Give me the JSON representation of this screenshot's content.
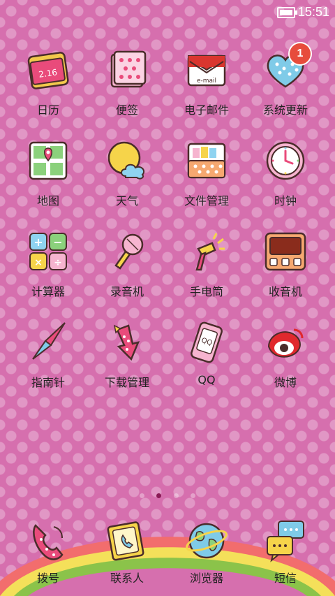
{
  "status_bar": {
    "time": "15:51",
    "battery_icon": "battery-icon"
  },
  "apps": [
    {
      "label": "日历",
      "icon": "calendar-icon",
      "icon_text": "2.16"
    },
    {
      "label": "便签",
      "icon": "notes-icon"
    },
    {
      "label": "电子邮件",
      "icon": "email-icon",
      "icon_text": "e-mail"
    },
    {
      "label": "系统更新",
      "icon": "update-heart-icon",
      "badge": "1"
    },
    {
      "label": "地图",
      "icon": "map-icon"
    },
    {
      "label": "天气",
      "icon": "weather-icon"
    },
    {
      "label": "文件管理",
      "icon": "file-manager-icon"
    },
    {
      "label": "时钟",
      "icon": "clock-icon"
    },
    {
      "label": "计算器",
      "icon": "calculator-icon"
    },
    {
      "label": "录音机",
      "icon": "recorder-icon"
    },
    {
      "label": "手电筒",
      "icon": "flashlight-icon"
    },
    {
      "label": "收音机",
      "icon": "radio-icon"
    },
    {
      "label": "指南针",
      "icon": "compass-icon"
    },
    {
      "label": "下载管理",
      "icon": "download-icon"
    },
    {
      "label": "QQ",
      "icon": "qq-icon",
      "icon_text": "QQ"
    },
    {
      "label": "微博",
      "icon": "weibo-icon"
    }
  ],
  "page_indicator": {
    "count": 4,
    "active": 1
  },
  "dock": [
    {
      "label": "拨号",
      "icon": "phone-icon"
    },
    {
      "label": "联系人",
      "icon": "contacts-icon"
    },
    {
      "label": "浏览器",
      "icon": "browser-icon"
    },
    {
      "label": "短信",
      "icon": "sms-icon"
    }
  ],
  "colors": {
    "background": "#d66fae",
    "badge": "#e74c3c"
  }
}
